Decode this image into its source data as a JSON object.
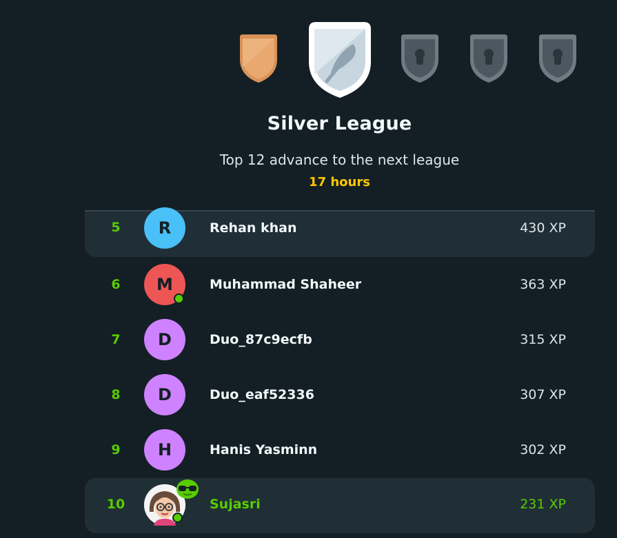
{
  "league": {
    "title": "Silver League",
    "subtitle": "Top 12 advance to the next league",
    "timer": "17 hours"
  },
  "badges": [
    {
      "name": "bronze-league-badge",
      "state": "completed",
      "color": "#e8a870"
    },
    {
      "name": "silver-league-badge",
      "state": "current",
      "color": "#c8d6e0"
    },
    {
      "name": "locked-league-badge",
      "state": "locked",
      "color": "#6f7b82"
    },
    {
      "name": "locked-league-badge",
      "state": "locked",
      "color": "#6f7b82"
    },
    {
      "name": "locked-league-badge",
      "state": "locked",
      "color": "#6f7b82"
    }
  ],
  "leaderboard": [
    {
      "rank": "5",
      "initial": "R",
      "name": "Rehan khan",
      "xp": "430 XP",
      "avatar_color": "#49c0f8",
      "online": false
    },
    {
      "rank": "6",
      "initial": "M",
      "name": "Muhammad Shaheer",
      "xp": "363 XP",
      "avatar_color": "#ee5555",
      "online": true
    },
    {
      "rank": "7",
      "initial": "D",
      "name": "Duo_87c9ecfb",
      "xp": "315 XP",
      "avatar_color": "#ce82ff",
      "online": false
    },
    {
      "rank": "8",
      "initial": "D",
      "name": "Duo_eaf52336",
      "xp": "307 XP",
      "avatar_color": "#ce82ff",
      "online": false
    },
    {
      "rank": "9",
      "initial": "H",
      "name": "Hanis Yasminn",
      "xp": "302 XP",
      "avatar_color": "#ce82ff",
      "online": false
    },
    {
      "rank": "10",
      "initial": "",
      "name": "Sujasri",
      "xp": "231 XP",
      "avatar_color": "#f4f4f4",
      "online": true,
      "current_user": true
    }
  ],
  "colors": {
    "background": "#131f24",
    "highlight": "#202f36",
    "accent_green": "#58cc02",
    "timer_yellow": "#ffc800"
  }
}
